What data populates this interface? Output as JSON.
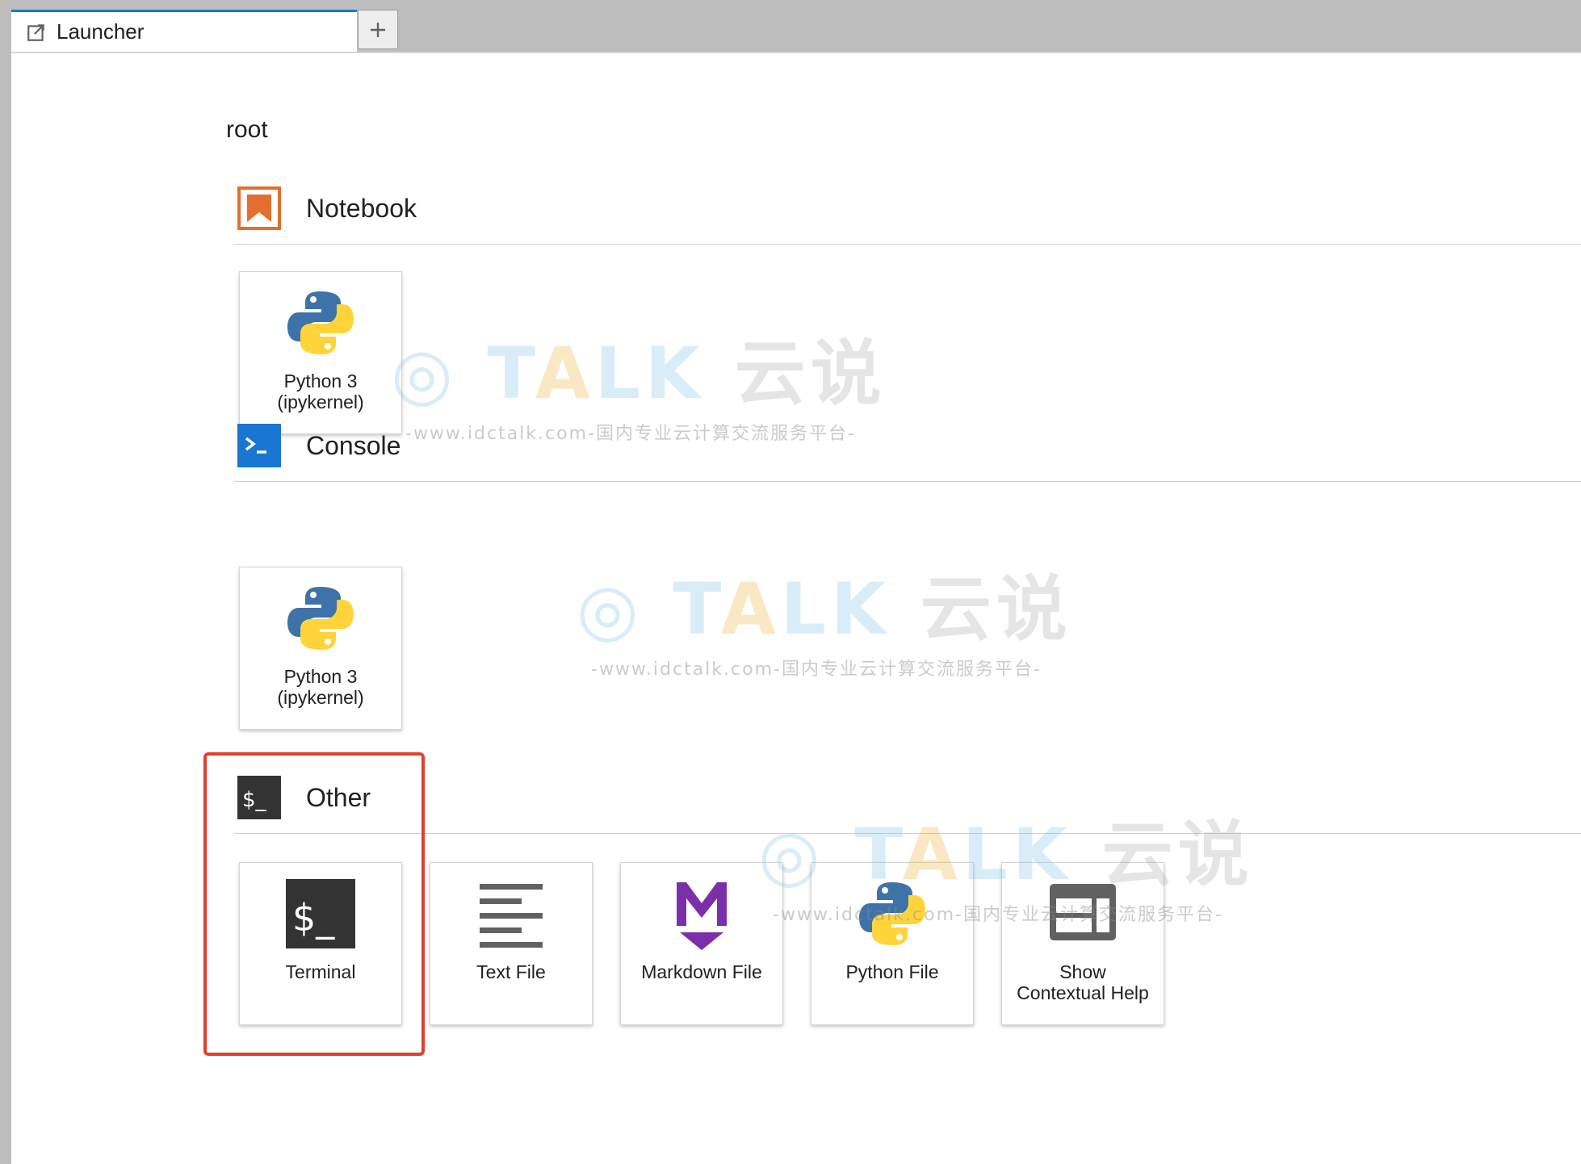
{
  "tabs": [
    {
      "label": "Launcher",
      "icon": "launch-icon",
      "active": true
    }
  ],
  "add_tab_icon": "plus-icon",
  "accent_color": "#1976d2",
  "cwd": "root",
  "sections": {
    "notebook": {
      "title": "Notebook",
      "icon": "notebook-icon",
      "icon_color": "#e46e2e",
      "cards": [
        {
          "label": "Python 3\n(ipykernel)",
          "icon": "python-logo-icon"
        }
      ]
    },
    "console": {
      "title": "Console",
      "icon": "console-icon",
      "icon_color": "#1976d2",
      "cards": [
        {
          "label": "Python 3\n(ipykernel)",
          "icon": "python-logo-icon"
        }
      ]
    },
    "other": {
      "title": "Other",
      "icon": "terminal-icon",
      "icon_color": "#333333",
      "cards": [
        {
          "label": "Terminal",
          "icon": "terminal-icon"
        },
        {
          "label": "Text File",
          "icon": "text-file-icon"
        },
        {
          "label": "Markdown File",
          "icon": "markdown-icon"
        },
        {
          "label": "Python File",
          "icon": "python-logo-icon"
        },
        {
          "label": "Show\nContextual Help",
          "icon": "contextual-help-icon"
        }
      ]
    }
  },
  "highlight_color": "#e0402e",
  "watermark": {
    "brand_t": "T",
    "brand_a": "A",
    "brand_lk": "LK",
    "brand_cn": "云说",
    "subtitle": "-www.idctalk.com-国内专业云计算交流服务平台-"
  }
}
